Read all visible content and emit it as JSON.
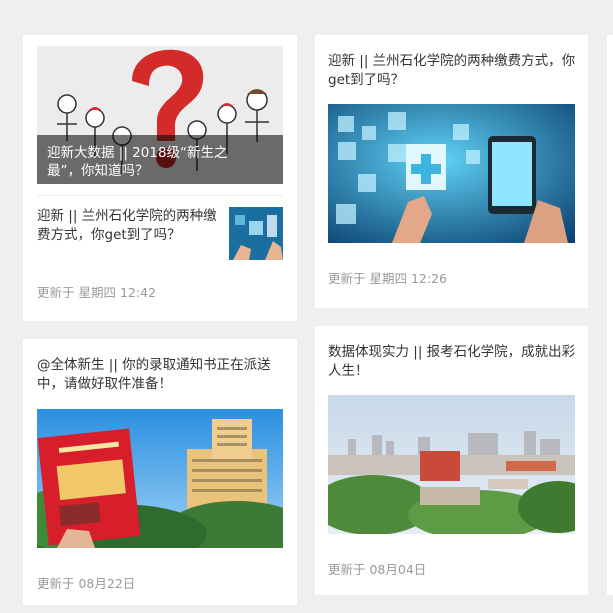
{
  "cards": [
    {
      "cover_title": "迎新大数据 || 2018级“新生之最”，你知道吗？",
      "sub_title": "迎新 || 兰州石化学院的两种缴费方式，你get到了吗？",
      "time": "更新于 星期四 12:42"
    },
    {
      "title": "迎新 || 兰州石化学院的两种缴费方式，你get到了吗？",
      "time": "更新于 星期四 12:26"
    },
    {
      "title": "@全体新生 || 你的录取通知书正在派送中，请做好取件准备！",
      "time": "更新于 08月22日"
    },
    {
      "title": "数据体现实力 || 报考石化学院，成就出彩人生！",
      "time": "更新于 08月04日"
    }
  ]
}
